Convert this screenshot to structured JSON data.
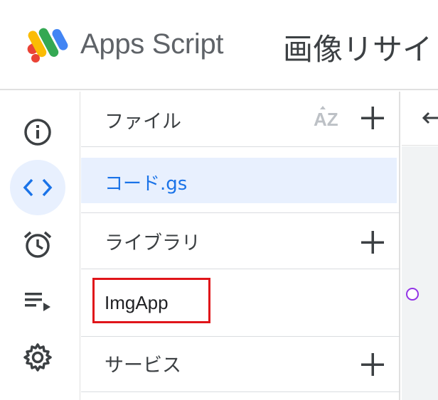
{
  "header": {
    "app_name": "Apps Script",
    "project_title": "画像リサイ"
  },
  "rail": {
    "items": [
      {
        "name": "overview",
        "icon": "info-icon"
      },
      {
        "name": "editor",
        "icon": "code-icon",
        "active": true
      },
      {
        "name": "triggers",
        "icon": "alarm-icon"
      },
      {
        "name": "executions",
        "icon": "playlist-play-icon"
      },
      {
        "name": "settings",
        "icon": "gear-icon"
      }
    ]
  },
  "panel": {
    "files_label": "ファイル",
    "sort_label": "AZ",
    "files": [
      {
        "name": "コード.gs",
        "selected": true
      }
    ],
    "libraries_label": "ライブラリ",
    "libraries": [
      {
        "name": "ImgApp"
      }
    ],
    "services_label": "サービス"
  },
  "colors": {
    "accent": "#1a73e8",
    "active_bg": "#e8f0fe",
    "highlight_box": "#e0151a",
    "marker": "#9334e6"
  }
}
